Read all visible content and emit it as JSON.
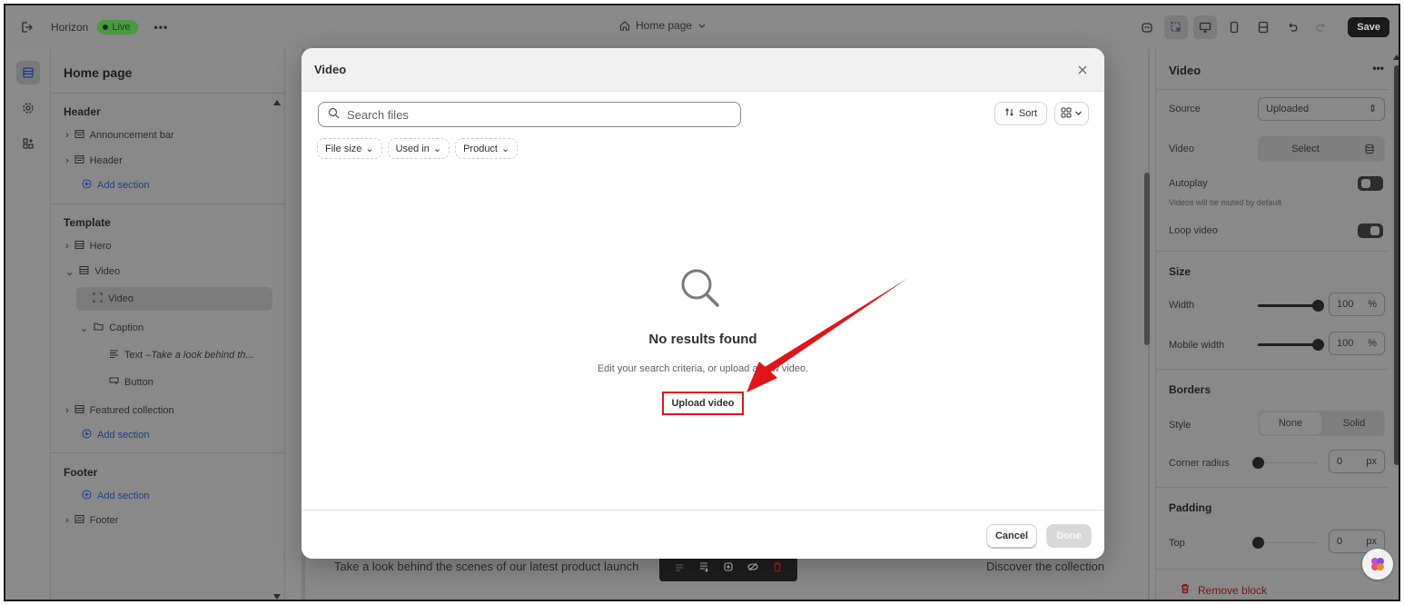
{
  "topbar": {
    "store_name": "Horizon",
    "status_badge": "Live",
    "more": "•••",
    "page_selector": "Home page",
    "save_label": "Save"
  },
  "left_panel": {
    "title": "Home page",
    "header_group": "Header",
    "header_items": [
      "Announcement bar",
      "Header"
    ],
    "add_section": "Add section",
    "template_group": "Template",
    "template_items": {
      "hero": "Hero",
      "video": "Video",
      "video_block": "Video",
      "caption": "Caption",
      "text": "Text – ",
      "text_italic": "Take a look behind th...",
      "button": "Button",
      "featured": "Featured collection"
    },
    "footer_group": "Footer",
    "footer_item": "Footer"
  },
  "canvas": {
    "behind_text": "Take a look behind the scenes of our latest product launch",
    "behind_link": "Discover the collection"
  },
  "modal": {
    "title": "Video",
    "search_placeholder": "Search files",
    "sort_label": "Sort",
    "filters": [
      "File size",
      "Used in",
      "Product"
    ],
    "empty_title": "No results found",
    "empty_subtitle": "Edit your search criteria, or upload a new video.",
    "upload_label": "Upload video",
    "cancel_label": "Cancel",
    "done_label": "Done"
  },
  "right_panel": {
    "title": "Video",
    "more": "•••",
    "source_label": "Source",
    "source_value": "Uploaded",
    "video_label": "Video",
    "select_label": "Select",
    "autoplay_label": "Autoplay",
    "autoplay_hint": "Videos will be muted by default",
    "autoplay_on": false,
    "loop_label": "Loop video",
    "loop_on": true,
    "size_heading": "Size",
    "width_label": "Width",
    "width_value": "100",
    "width_unit": "%",
    "width_fraction": 1.0,
    "mobile_width_label": "Mobile width",
    "mobile_width_value": "100",
    "mobile_width_unit": "%",
    "mobile_width_fraction": 1.0,
    "borders_heading": "Borders",
    "style_label": "Style",
    "style_options": [
      "None",
      "Solid"
    ],
    "style_selected": "None",
    "corner_radius_label": "Corner radius",
    "corner_radius_value": "0",
    "corner_radius_unit": "px",
    "corner_radius_fraction": 0,
    "padding_heading": "Padding",
    "top_label": "Top",
    "top_value": "0",
    "top_unit": "px",
    "top_fraction": 0,
    "remove_label": "Remove block"
  },
  "colors": {
    "live_green": "#4a9b3f",
    "annotation_red": "#e0141a",
    "link_blue": "#1d3f8a",
    "remove_red": "#7a1616"
  }
}
